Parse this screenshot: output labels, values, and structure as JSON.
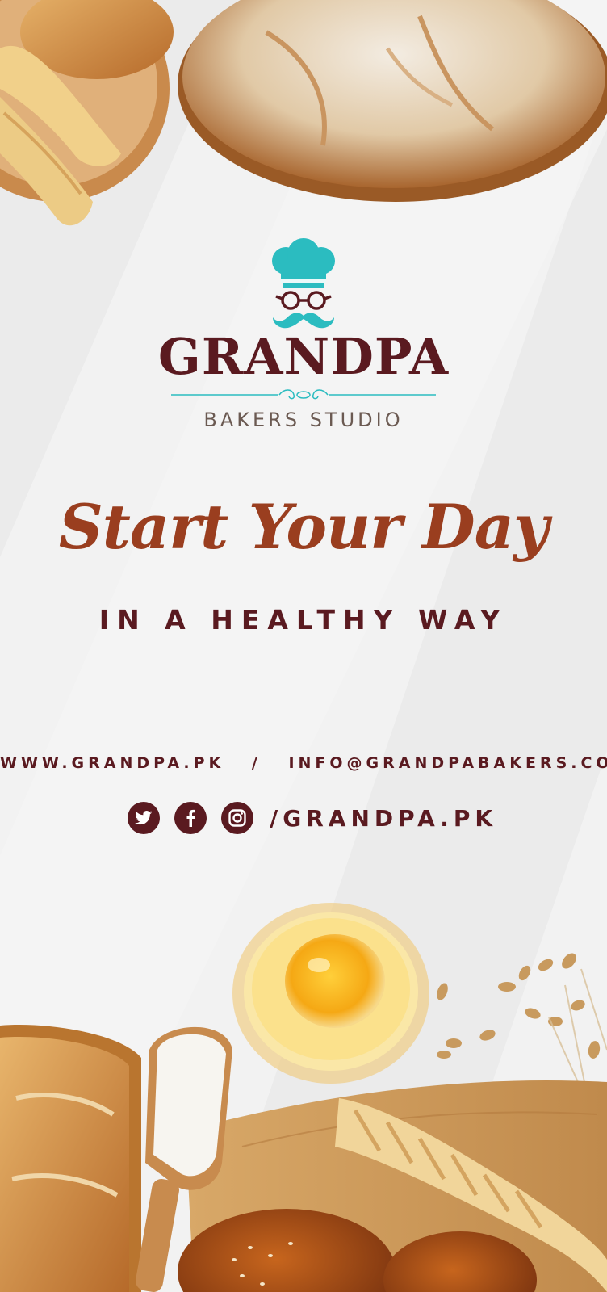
{
  "brand": {
    "name": "GRANDPA",
    "tagline": "BAKERS STUDIO",
    "logo_icon": "chef-hat-glasses-mustache-icon"
  },
  "headline": "Start Your Day",
  "subheadline": "IN A HEALTHY WAY",
  "contact": {
    "website": "WWW.GRANDPA.PK",
    "separator": "/",
    "email": "INFO@GRANDPABAKERS.COM"
  },
  "social": {
    "icons": [
      "twitter-icon",
      "facebook-icon",
      "instagram-icon"
    ],
    "handle": "/GRANDPA.PK"
  },
  "colors": {
    "teal": "#2bbcc0",
    "maroon": "#5a1a20",
    "headline": "#9a3e1f",
    "subtitle": "#6b5a52",
    "background": "#ececec"
  }
}
